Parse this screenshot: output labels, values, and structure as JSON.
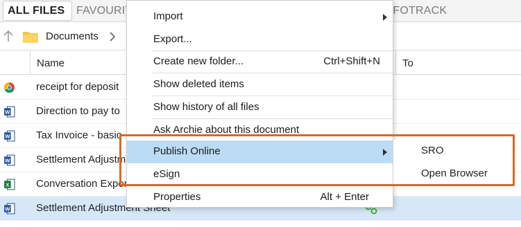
{
  "tabs": [
    {
      "label": "ALL FILES"
    },
    {
      "label": "FAVOURITES"
    },
    {
      "label": "INFOTRACK"
    }
  ],
  "breadcrumb": {
    "current": "Documents"
  },
  "columns": {
    "name": "Name",
    "to": "To"
  },
  "files": [
    {
      "name": "receipt for deposit",
      "type": "chrome"
    },
    {
      "name": "Direction to pay to",
      "type": "word"
    },
    {
      "name": "Tax Invoice - basic",
      "type": "word"
    },
    {
      "name": "Settlement Adjustment",
      "type": "word"
    },
    {
      "name": "Conversation Export",
      "type": "excel"
    },
    {
      "name": "Settlement Adjustment Sheet",
      "type": "word"
    }
  ],
  "menu": {
    "import": "Import",
    "export": "Export...",
    "new_folder": "Create new folder...",
    "new_folder_shortcut": "Ctrl+Shift+N",
    "show_deleted": "Show deleted items",
    "show_history": "Show history of all files",
    "ask_archie": "Ask Archie about this document",
    "publish_online": "Publish Online",
    "esign": "eSign",
    "properties": "Properties",
    "properties_shortcut": "Alt + Enter"
  },
  "submenu": {
    "sro": "SRO",
    "open_browser": "Open Browser"
  },
  "colors": {
    "annotation": "#e0651d",
    "menu_highlight": "#bcdcf5",
    "selected_row": "#d6e8f7",
    "word_blue": "#2b579a",
    "excel_green": "#217346",
    "folder_yellow": "#f6c343"
  },
  "icons": {
    "chrome": "chrome-icon",
    "word": "word-doc-icon",
    "excel": "excel-doc-icon",
    "folder": "folder-icon",
    "up": "up-arrow-icon",
    "chevron": "chevron-right-icon",
    "share": "share-icon"
  }
}
